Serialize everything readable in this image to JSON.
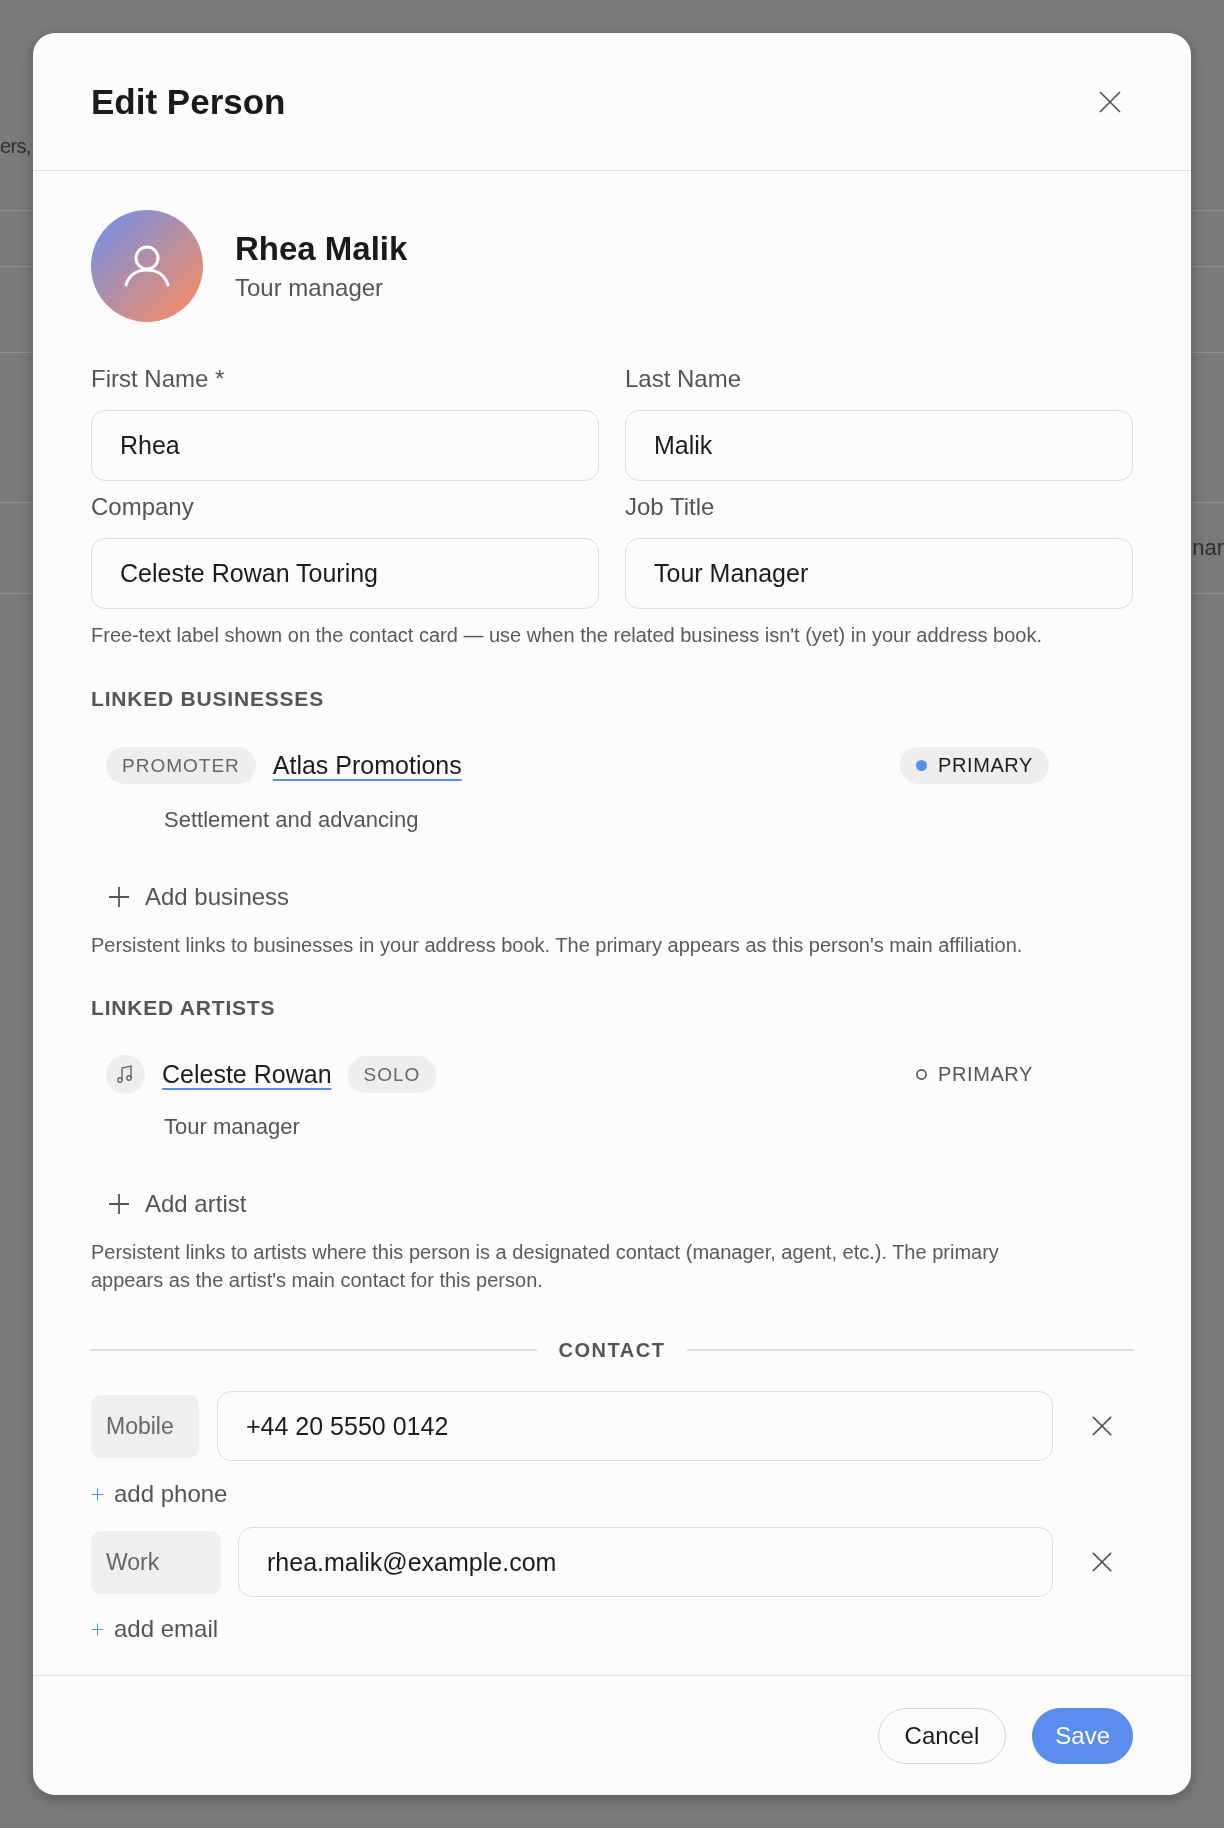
{
  "background": {
    "left_text": "ers,",
    "right_text": "nar"
  },
  "dialog": {
    "title": "Edit Person"
  },
  "profile": {
    "name": "Rhea Malik",
    "subtitle": "Tour manager"
  },
  "fields": [
    {
      "label": "First Name *",
      "value": "Rhea"
    },
    {
      "label": "Last Name",
      "value": "Malik"
    },
    {
      "label": "Company",
      "value": "Celeste Rowan Touring"
    },
    {
      "label": "Job Title",
      "value": "Tour Manager"
    }
  ],
  "fields_hint": "Free-text label shown on the contact card — use when the related business isn't (yet) in your address book.",
  "linked_businesses": {
    "heading": "LINKED BUSINESSES",
    "items": [
      {
        "tag": "PROMOTER",
        "name": "Atlas Promotions",
        "primary_label": "PRIMARY",
        "primary": true,
        "note": "Settlement and advancing"
      }
    ],
    "add_label": "Add business",
    "hint": "Persistent links to businesses in your address book. The primary appears as this person's main affiliation."
  },
  "linked_artists": {
    "heading": "LINKED ARTISTS",
    "items": [
      {
        "name": "Celeste Rowan",
        "tag": "SOLO",
        "primary_label": "PRIMARY",
        "primary": false,
        "note": "Tour manager"
      }
    ],
    "add_label": "Add artist",
    "hint": "Persistent links to artists where this person is a designated contact (manager, agent, etc.). The primary appears as the artist's main contact for this person."
  },
  "contact": {
    "heading": "CONTACT",
    "phones": [
      {
        "type": "Mobile",
        "value": "+44 20 5550 0142"
      }
    ],
    "add_phone": "add phone",
    "emails": [
      {
        "type": "Work",
        "value": "rhea.malik@example.com"
      }
    ],
    "add_email": "add email"
  },
  "footer": {
    "buttons": [
      {
        "label": "Cancel",
        "kind": "secondary"
      },
      {
        "label": "Save",
        "kind": "primary"
      }
    ]
  }
}
